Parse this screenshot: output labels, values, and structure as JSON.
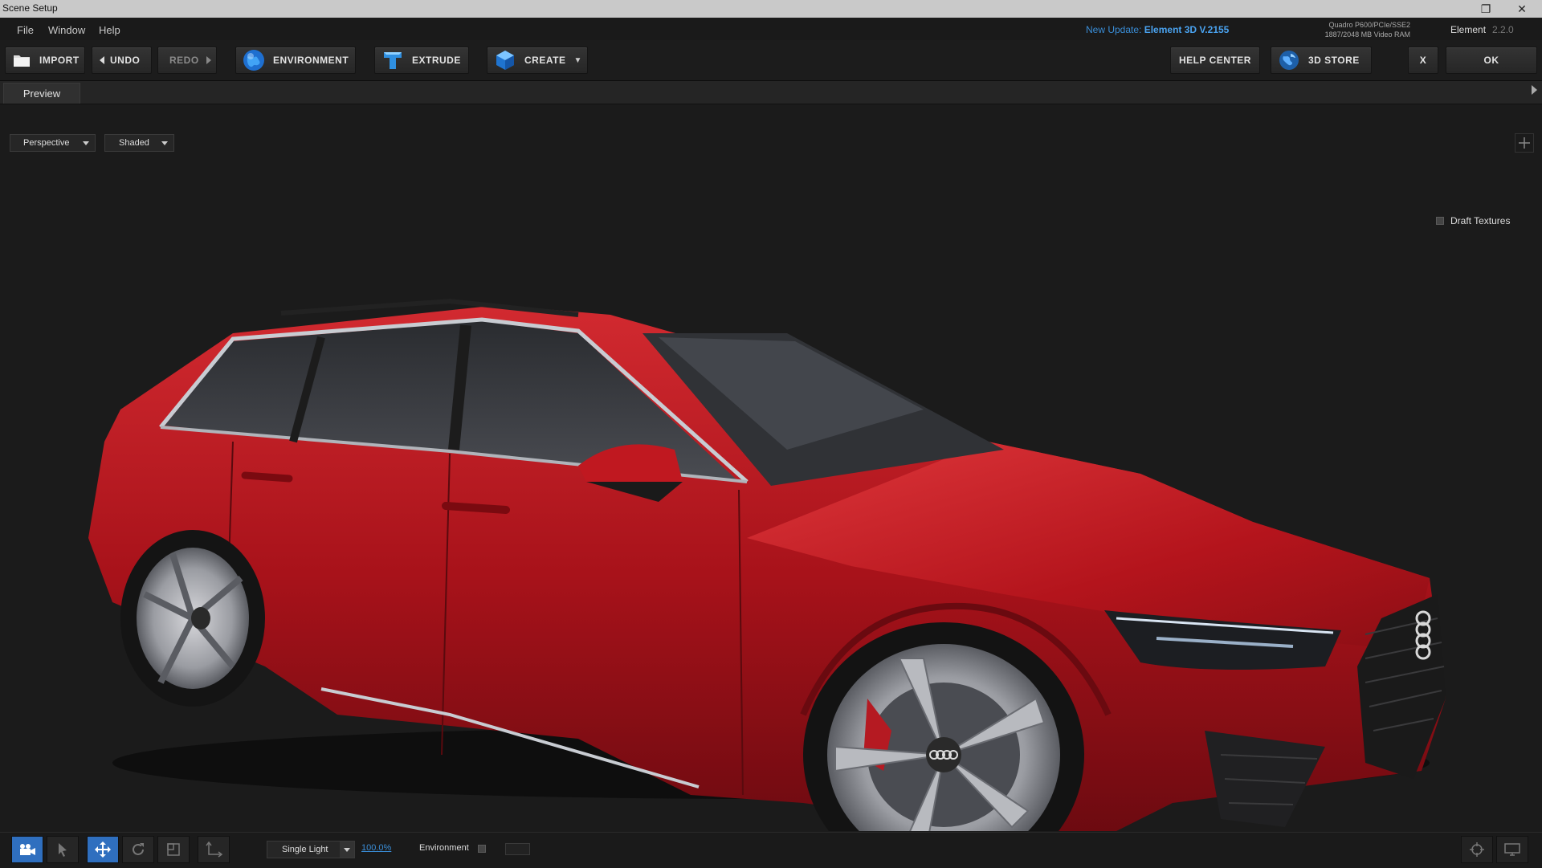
{
  "window": {
    "title": "Scene Setup",
    "restore_glyph": "❐",
    "close_glyph": "✕"
  },
  "menu": {
    "items": [
      "File",
      "Window",
      "Help"
    ]
  },
  "update": {
    "prefix": "New Update:",
    "label": "Element 3D V.2155"
  },
  "gpu": {
    "line1": "Quadro P600/PCIe/SSE2",
    "line2": "1887/2048 MB Video RAM"
  },
  "product": {
    "name": "Element",
    "version": "2.2.0"
  },
  "toolbar": {
    "import": "IMPORT",
    "undo": "UNDO",
    "redo": "REDO",
    "environment": "ENVIRONMENT",
    "extrude": "EXTRUDE",
    "create": "CREATE",
    "help_center": "HELP CENTER",
    "store": "3D STORE",
    "close": "X",
    "ok": "OK"
  },
  "tabs": {
    "preview": "Preview"
  },
  "viewport": {
    "draft_textures_label": "Draft Textures",
    "camera_view": "Perspective",
    "shading": "Shaded",
    "model_description": "red car model"
  },
  "bottom": {
    "light_mode": "Single Light",
    "light_intensity": "100.0%",
    "environment_label": "Environment"
  },
  "colors": {
    "accent": "#3a8ed8",
    "active_tool": "#2f6fbf",
    "car_body": "#b3141c"
  }
}
